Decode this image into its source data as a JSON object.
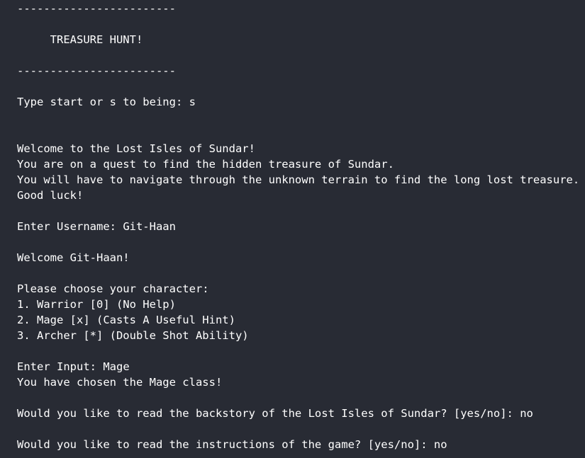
{
  "terminal": {
    "divider_top": "------------------------",
    "title": "     TREASURE HUNT!",
    "divider_bottom": "------------------------",
    "start_prompt": "Type start or s to being: ",
    "start_input": "s",
    "welcome_lines": [
      "Welcome to the Lost Isles of Sundar!",
      "You are on a quest to find the hidden treasure of Sundar.",
      "You will have to navigate through the unknown terrain to find the long lost treasure.",
      "Good luck!"
    ],
    "username_prompt": "Enter Username: ",
    "username_input": "Git-Haan",
    "welcome_user": "Welcome Git-Haan!",
    "choose_header": "Please choose your character:",
    "characters": [
      "1. Warrior [0] (No Help)",
      "2. Mage [x] (Casts A Useful Hint)",
      "3. Archer [*] (Double Shot Ability)"
    ],
    "input_prompt": "Enter Input: ",
    "input_value": "Mage",
    "chosen_class": "You have chosen the Mage class!",
    "backstory_prompt": "Would you like to read the backstory of the Lost Isles of Sundar? [yes/no]: ",
    "backstory_answer": "no",
    "instructions_prompt": "Would you like to read the instructions of the game? [yes/no]: ",
    "instructions_answer": "no"
  }
}
